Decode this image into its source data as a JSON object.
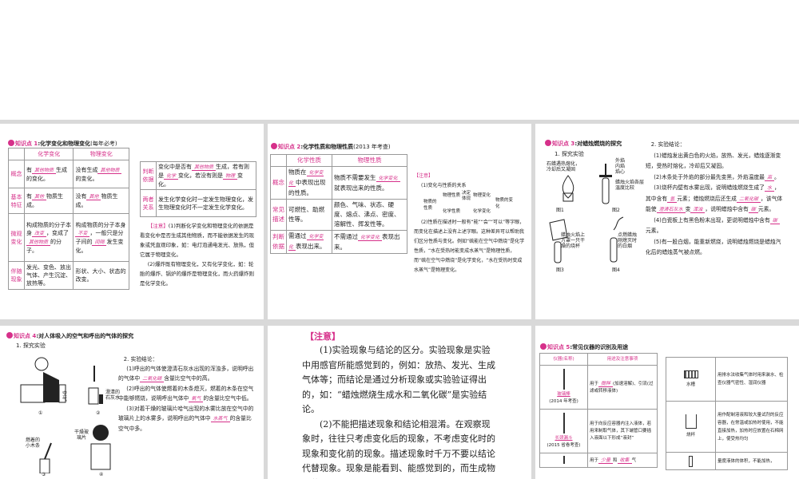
{
  "s1": {
    "kp": "知识点 1",
    "title": "化学变化和物理变化",
    "year": "(每年必考)",
    "headers": [
      "",
      "化学变化",
      "物理变化"
    ],
    "rows": [
      [
        "概念",
        [
          "有",
          {
            "b": "其他物质"
          },
          "生成的变化。"
        ],
        [
          "没有生成",
          {
            "b": "其他物质"
          },
          "的变化。"
        ]
      ],
      [
        "基本特征",
        [
          "有",
          {
            "b": "其他"
          },
          "物质生成。"
        ],
        [
          "没有",
          {
            "b": "其他"
          },
          "物质生成。"
        ]
      ],
      [
        "微观变化",
        [
          "构成物质的分子本身",
          {
            "b": "改变"
          },
          "，变成了",
          {
            "b": "其他物质"
          },
          "的分子。"
        ],
        [
          "构成物质的分子本身",
          {
            "b": "不变"
          },
          "，一般只是分子间的",
          {
            "b": "间隔"
          },
          "发生变化。"
        ]
      ],
      [
        "伴随现象",
        [
          "发光、变色、放出气体、产生沉淀、放热等。"
        ],
        [
          "形状、大小、状态的改变。"
        ]
      ]
    ],
    "rows2": [
      [
        "判断依据",
        [
          "变化中是否有",
          {
            "b": "其他物质"
          },
          "生成，若有则是",
          {
            "b": "化学"
          },
          "变化，若没有则是",
          {
            "b": "物理"
          },
          "变化。"
        ]
      ],
      [
        "两者关系",
        [
          "发生化学变化时一定发生物理变化，发生物理变化时不一定发生化学变化。"
        ]
      ]
    ],
    "note": [
      [
        "【注意】",
        "(1)判断化学变化和物理变化的依据是看变化中是否生成其他物质，而不能依据发生的现象或凭直观印象，如：电灯泡通电发光、放热，但它属于物理变化。"
      ],
      [
        "",
        "(2)爆炸既有物理变化，又有化学变化，如：轮胎的爆炸、锅炉的爆炸是物理变化，而火药爆炸则是化学变化。"
      ]
    ]
  },
  "s2": {
    "kp": "知识点 2",
    "title": "化学性质和物理性质",
    "year": "(2013 年考查)",
    "headers": [
      "",
      "化学性质",
      "物理性质"
    ],
    "rows": [
      [
        "概念",
        [
          "物质在",
          {
            "b": "化学变化"
          },
          "中表现出现的性质。"
        ],
        [
          "物质不需要发生",
          {
            "b": "化学变化"
          },
          "就表现出来的性质。"
        ]
      ],
      [
        "常见描述",
        [
          "可燃性、助燃性等。"
        ],
        [
          "颜色、气味、状态、硬度、熔点、沸点、密度、溶解性、挥发性等。"
        ]
      ],
      [
        "判断依据",
        [
          "需通过",
          {
            "b": "化学变化"
          },
          "表现出来。"
        ],
        [
          "不需通过",
          {
            "b": "化学变化"
          },
          "表现出来。"
        ]
      ]
    ],
    "note_h": "【注意】",
    "note1": "(1)变化与性质的关系",
    "rel": {
      "left": "物质的性质",
      "a": "物理性质",
      "b": "化学性质",
      "up": "决定",
      "down": "体现",
      "a2": "物理变化",
      "b2": "化学变化",
      "right": "物质的变化"
    },
    "note2": "(2)性质在描述时一般有“能”“会”“可以”等字眼，而变化在描述上没有上述字眼。这种差异可以帮助我们区分性质与变化。例如“硫能在空气中燃烧”是化学性质，“水在受热时能变成水蒸气”是物理性质，而“硫在空气中燃烧”是化学变化，“水在受热时变成水蒸气”是物理变化。"
  },
  "s3": {
    "kp": "知识点 3",
    "title": "对蜡烛燃烧的探究",
    "sub1": "1. 探究实验",
    "fig1": "石蜡遇热熔化，冷却后又凝固",
    "fig2a": "外焰 内焰 焰心",
    "fig2b": "蜡烛火焰各层温度比较",
    "fig3": "蜡烛火焰上方罩一只干燥的烧杯",
    "fig4": "点燃蜡烛刚熄灭时的白烟",
    "figs": [
      "图1",
      "图2",
      "图3",
      "图4"
    ],
    "sub2": "2. 实验结论：",
    "paras": [
      [
        "(1)蜡烛发出黄白色的火焰，放热、发光，蜡烛逐渐变短，受热时熔化，冷却后又凝固。"
      ],
      [
        "(2)木条处于外焰的部分最先变黑，外焰温度最",
        {
          "b": "高"
        },
        "。"
      ],
      [
        "(3)烧杯内壁有水雾出现，说明蜡烛燃烧生成了",
        {
          "b": "水"
        },
        "，其中含有",
        {
          "b": "氢"
        },
        "元素；蜡烛燃烧后还生成",
        {
          "b": "二氧化碳"
        },
        "，该气体能使",
        {
          "b": "澄清石灰水"
        },
        "变",
        {
          "b": "浑浊"
        },
        "，说明蜡烛中含有",
        {
          "b": "碳"
        },
        "元素。"
      ],
      [
        "(4)白瓷板上有黑色粉末出现，更说明蜡烛中含有",
        {
          "b": "碳"
        },
        "元素。"
      ],
      [
        "(5)有一股白烟，能重新燃烧，说明蜡烛燃烧是蜡烛汽化后的蜡烛蒸气被点燃。"
      ]
    ]
  },
  "s4": {
    "kp": "知识点 4",
    "title": "对人体吸入的空气和呼出的气体的探究",
    "sub1": "1. 探究实验",
    "lab_air": "空气",
    "lab_lime": "澄清的石灰水",
    "lab_stick": "燃着的小木条",
    "lab_glass": "干燥玻璃片",
    "nums": [
      "①",
      "②",
      "③",
      "④"
    ],
    "sub2": "2. 实验结论：",
    "paras": [
      [
        "(1)呼出的气体使澄清石灰水出现的浑浊多，说明呼出的气体中",
        {
          "b": "二氧化碳"
        },
        "含量比空气中的高。"
      ],
      [
        "(2)呼出的气体使燃着的木条熄灭，燃着的木条在空气中能够燃烧，说明呼出气体中",
        {
          "b": "氧气"
        },
        "的含量比空气中低。"
      ],
      [
        "(3)对着干燥的玻璃片哈气出现的水雾比放在空气中的玻璃片上的水雾多，说明呼出的气体中",
        {
          "b": "水蒸气"
        },
        "的含量比空气中多。"
      ]
    ]
  },
  "s5": {
    "note_h": "【注意】",
    "p1": "(1)实验现象与结论的区分。实验现象是实验中用感官所能感觉到的，例如：放热、发光、生成气体等；而结论是通过分析现象或实验验证得出的，如：“蜡烛燃烧生成水和二氧化碳”是实验结论。",
    "p2": "(2)不能把描述现象和结论相混淆。在观察现象时，往往只考虑变化后的现象，不考虑变化时的现象和变化前的现象。描述现象时千万不要以结论代替现象。现象是能看到、能感觉到的，而生成物是什"
  },
  "s6": {
    "kp": "知识点 5",
    "title": "常见仪器的识别及用途",
    "headers": [
      "仪器(名称)",
      "用途及注意事项"
    ],
    "rows": [
      {
        "name": "玻璃棒",
        "exam": "(2014 年考查)",
        "use": [
          "用于",
          {
            "b": "搅拌"
          },
          "(加速溶解)、引流(过滤或转移液体)"
        ]
      },
      {
        "name": "长颈漏斗",
        "exam": "(2015 省卷考查)",
        "use": [
          "用于向反应容器内注入液体，若用来制取气体，其下端管口要插入液面以下形成“液封”"
        ]
      },
      {
        "name": "",
        "exam": "",
        "use": [
          "用于",
          {
            "b": "少量"
          },
          "和",
          {
            "b": "收集"
          },
          "气"
        ]
      }
    ],
    "rows2": [
      {
        "name": "水槽",
        "use": [
          "用排水法收集气体时用来装水、检查仪器气密性、湿润仪器"
        ]
      },
      {
        "name": "烧杯",
        "use": [
          "用作配制溶液和较大量试剂的反应容器，在常温或加热时使用，不能直接加热，加热时应放置在石棉网上，使受热均匀"
        ]
      },
      {
        "name": "",
        "use": [
          "量度液体的体积，不能加热，"
        ]
      }
    ]
  },
  "colors": {
    "accent": "#d6308a"
  }
}
